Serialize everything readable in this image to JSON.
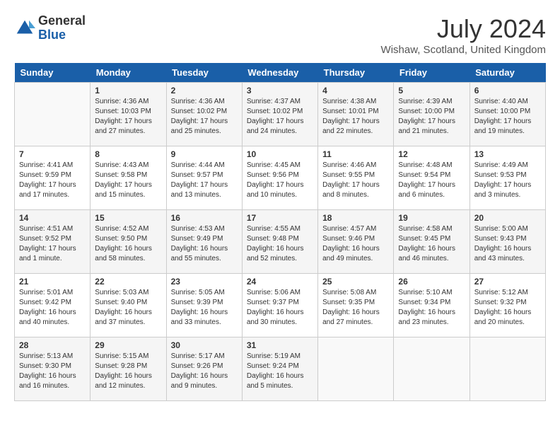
{
  "header": {
    "logo": {
      "general": "General",
      "blue": "Blue"
    },
    "title": "July 2024",
    "location": "Wishaw, Scotland, United Kingdom"
  },
  "calendar": {
    "days_of_week": [
      "Sunday",
      "Monday",
      "Tuesday",
      "Wednesday",
      "Thursday",
      "Friday",
      "Saturday"
    ],
    "weeks": [
      [
        {
          "day": "",
          "info": ""
        },
        {
          "day": "1",
          "info": "Sunrise: 4:36 AM\nSunset: 10:03 PM\nDaylight: 17 hours\nand 27 minutes."
        },
        {
          "day": "2",
          "info": "Sunrise: 4:36 AM\nSunset: 10:02 PM\nDaylight: 17 hours\nand 25 minutes."
        },
        {
          "day": "3",
          "info": "Sunrise: 4:37 AM\nSunset: 10:02 PM\nDaylight: 17 hours\nand 24 minutes."
        },
        {
          "day": "4",
          "info": "Sunrise: 4:38 AM\nSunset: 10:01 PM\nDaylight: 17 hours\nand 22 minutes."
        },
        {
          "day": "5",
          "info": "Sunrise: 4:39 AM\nSunset: 10:00 PM\nDaylight: 17 hours\nand 21 minutes."
        },
        {
          "day": "6",
          "info": "Sunrise: 4:40 AM\nSunset: 10:00 PM\nDaylight: 17 hours\nand 19 minutes."
        }
      ],
      [
        {
          "day": "7",
          "info": "Sunrise: 4:41 AM\nSunset: 9:59 PM\nDaylight: 17 hours\nand 17 minutes."
        },
        {
          "day": "8",
          "info": "Sunrise: 4:43 AM\nSunset: 9:58 PM\nDaylight: 17 hours\nand 15 minutes."
        },
        {
          "day": "9",
          "info": "Sunrise: 4:44 AM\nSunset: 9:57 PM\nDaylight: 17 hours\nand 13 minutes."
        },
        {
          "day": "10",
          "info": "Sunrise: 4:45 AM\nSunset: 9:56 PM\nDaylight: 17 hours\nand 10 minutes."
        },
        {
          "day": "11",
          "info": "Sunrise: 4:46 AM\nSunset: 9:55 PM\nDaylight: 17 hours\nand 8 minutes."
        },
        {
          "day": "12",
          "info": "Sunrise: 4:48 AM\nSunset: 9:54 PM\nDaylight: 17 hours\nand 6 minutes."
        },
        {
          "day": "13",
          "info": "Sunrise: 4:49 AM\nSunset: 9:53 PM\nDaylight: 17 hours\nand 3 minutes."
        }
      ],
      [
        {
          "day": "14",
          "info": "Sunrise: 4:51 AM\nSunset: 9:52 PM\nDaylight: 17 hours\nand 1 minute."
        },
        {
          "day": "15",
          "info": "Sunrise: 4:52 AM\nSunset: 9:50 PM\nDaylight: 16 hours\nand 58 minutes."
        },
        {
          "day": "16",
          "info": "Sunrise: 4:53 AM\nSunset: 9:49 PM\nDaylight: 16 hours\nand 55 minutes."
        },
        {
          "day": "17",
          "info": "Sunrise: 4:55 AM\nSunset: 9:48 PM\nDaylight: 16 hours\nand 52 minutes."
        },
        {
          "day": "18",
          "info": "Sunrise: 4:57 AM\nSunset: 9:46 PM\nDaylight: 16 hours\nand 49 minutes."
        },
        {
          "day": "19",
          "info": "Sunrise: 4:58 AM\nSunset: 9:45 PM\nDaylight: 16 hours\nand 46 minutes."
        },
        {
          "day": "20",
          "info": "Sunrise: 5:00 AM\nSunset: 9:43 PM\nDaylight: 16 hours\nand 43 minutes."
        }
      ],
      [
        {
          "day": "21",
          "info": "Sunrise: 5:01 AM\nSunset: 9:42 PM\nDaylight: 16 hours\nand 40 minutes."
        },
        {
          "day": "22",
          "info": "Sunrise: 5:03 AM\nSunset: 9:40 PM\nDaylight: 16 hours\nand 37 minutes."
        },
        {
          "day": "23",
          "info": "Sunrise: 5:05 AM\nSunset: 9:39 PM\nDaylight: 16 hours\nand 33 minutes."
        },
        {
          "day": "24",
          "info": "Sunrise: 5:06 AM\nSunset: 9:37 PM\nDaylight: 16 hours\nand 30 minutes."
        },
        {
          "day": "25",
          "info": "Sunrise: 5:08 AM\nSunset: 9:35 PM\nDaylight: 16 hours\nand 27 minutes."
        },
        {
          "day": "26",
          "info": "Sunrise: 5:10 AM\nSunset: 9:34 PM\nDaylight: 16 hours\nand 23 minutes."
        },
        {
          "day": "27",
          "info": "Sunrise: 5:12 AM\nSunset: 9:32 PM\nDaylight: 16 hours\nand 20 minutes."
        }
      ],
      [
        {
          "day": "28",
          "info": "Sunrise: 5:13 AM\nSunset: 9:30 PM\nDaylight: 16 hours\nand 16 minutes."
        },
        {
          "day": "29",
          "info": "Sunrise: 5:15 AM\nSunset: 9:28 PM\nDaylight: 16 hours\nand 12 minutes."
        },
        {
          "day": "30",
          "info": "Sunrise: 5:17 AM\nSunset: 9:26 PM\nDaylight: 16 hours\nand 9 minutes."
        },
        {
          "day": "31",
          "info": "Sunrise: 5:19 AM\nSunset: 9:24 PM\nDaylight: 16 hours\nand 5 minutes."
        },
        {
          "day": "",
          "info": ""
        },
        {
          "day": "",
          "info": ""
        },
        {
          "day": "",
          "info": ""
        }
      ]
    ]
  }
}
